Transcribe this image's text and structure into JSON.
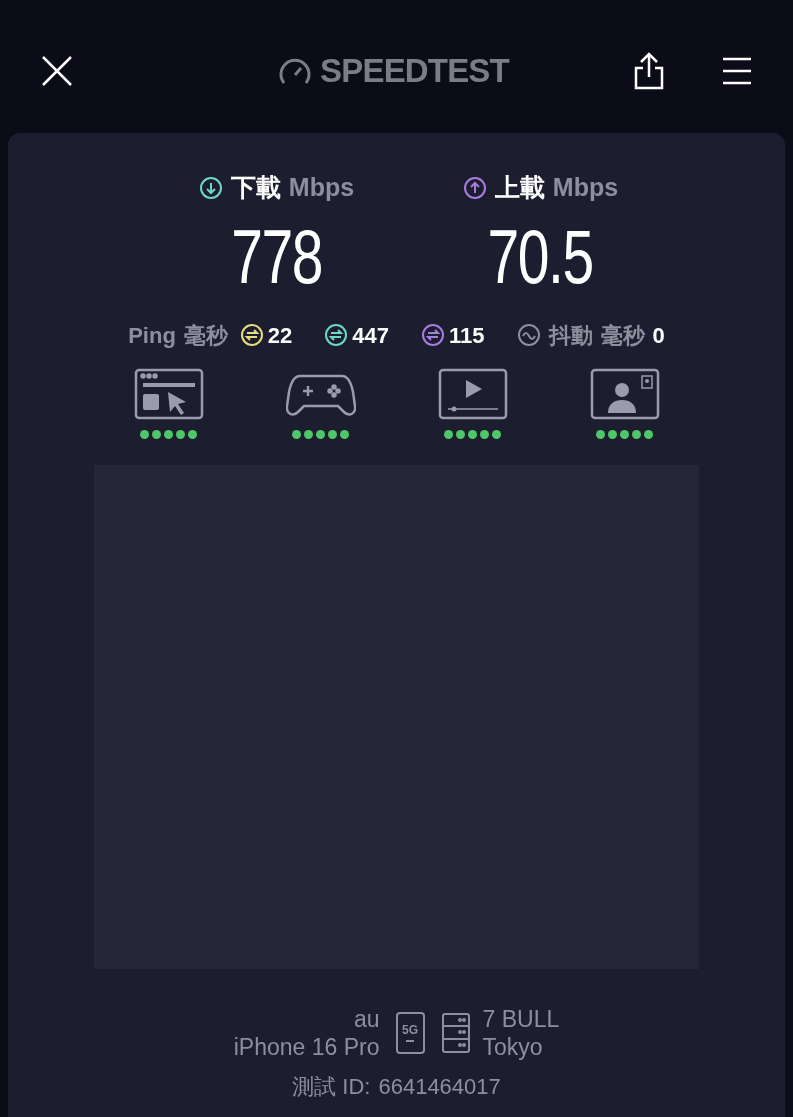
{
  "header": {
    "logo": "SPEEDTEST"
  },
  "download": {
    "label": "下載",
    "unit": "Mbps",
    "value": "778",
    "color": "#6fd6c8"
  },
  "upload": {
    "label": "上載",
    "unit": "Mbps",
    "value": "70.5",
    "color": "#a77de0"
  },
  "ping": {
    "label": "Ping",
    "unit": "毫秒",
    "items": [
      {
        "value": "22",
        "color": "#e6dd7c"
      },
      {
        "value": "447",
        "color": "#6fd6c8"
      },
      {
        "value": "115",
        "color": "#a77de0"
      }
    ]
  },
  "jitter": {
    "label": "抖動",
    "unit": "毫秒",
    "value": "0"
  },
  "activities": [
    {
      "kind": "browsing",
      "stars": 5
    },
    {
      "kind": "gaming",
      "stars": 5
    },
    {
      "kind": "video",
      "stars": 5
    },
    {
      "kind": "video-call",
      "stars": 5
    }
  ],
  "connection": {
    "carrier": "au",
    "device": "iPhone 16 Pro",
    "network": "5G",
    "server": "7 BULL",
    "location": "Tokyo"
  },
  "test_id": {
    "label": "測試 ID:",
    "value": "6641464017"
  }
}
